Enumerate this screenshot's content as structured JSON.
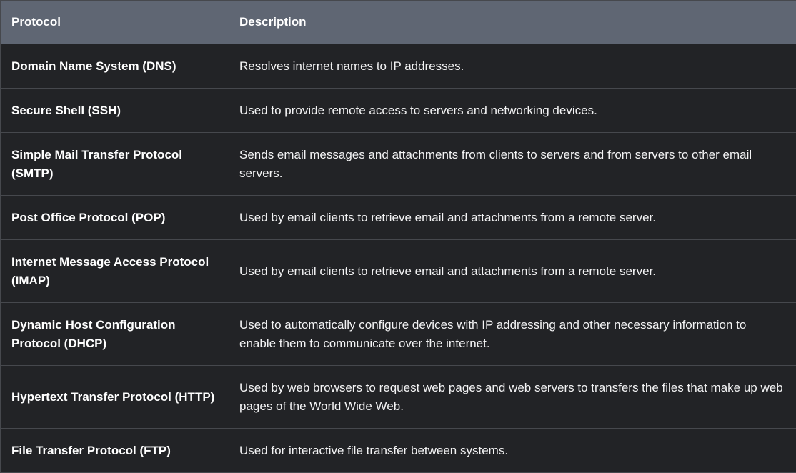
{
  "table": {
    "headers": [
      "Protocol",
      "Description"
    ],
    "rows": [
      {
        "protocol": "Domain Name System (DNS)",
        "description": "Resolves internet names to IP addresses."
      },
      {
        "protocol": "Secure Shell (SSH)",
        "description": "Used to provide remote access to servers and networking devices."
      },
      {
        "protocol": "Simple Mail Transfer Protocol (SMTP)",
        "description": "Sends email messages and attachments from clients to servers and from servers to other email servers."
      },
      {
        "protocol": "Post Office Protocol (POP)",
        "description": "Used by email clients to retrieve email and attachments from a remote server."
      },
      {
        "protocol": "Internet Message Access Protocol (IMAP)",
        "description": "Used by email clients to retrieve email and attachments from a remote server."
      },
      {
        "protocol": "Dynamic Host Configuration Protocol (DHCP)",
        "description": "Used to automatically configure devices with IP addressing and other necessary information to enable them to communicate over the internet."
      },
      {
        "protocol": "Hypertext Transfer Protocol (HTTP)",
        "description": "Used by web browsers to request web pages and web servers to transfers the files that make up web pages of the World Wide Web."
      },
      {
        "protocol": "File Transfer Protocol (FTP)",
        "description": "Used for interactive file transfer between systems."
      }
    ]
  },
  "colors": {
    "header_background": "#5f6673",
    "body_background": "#222326",
    "border": "#46484d",
    "text": "#ffffff"
  }
}
